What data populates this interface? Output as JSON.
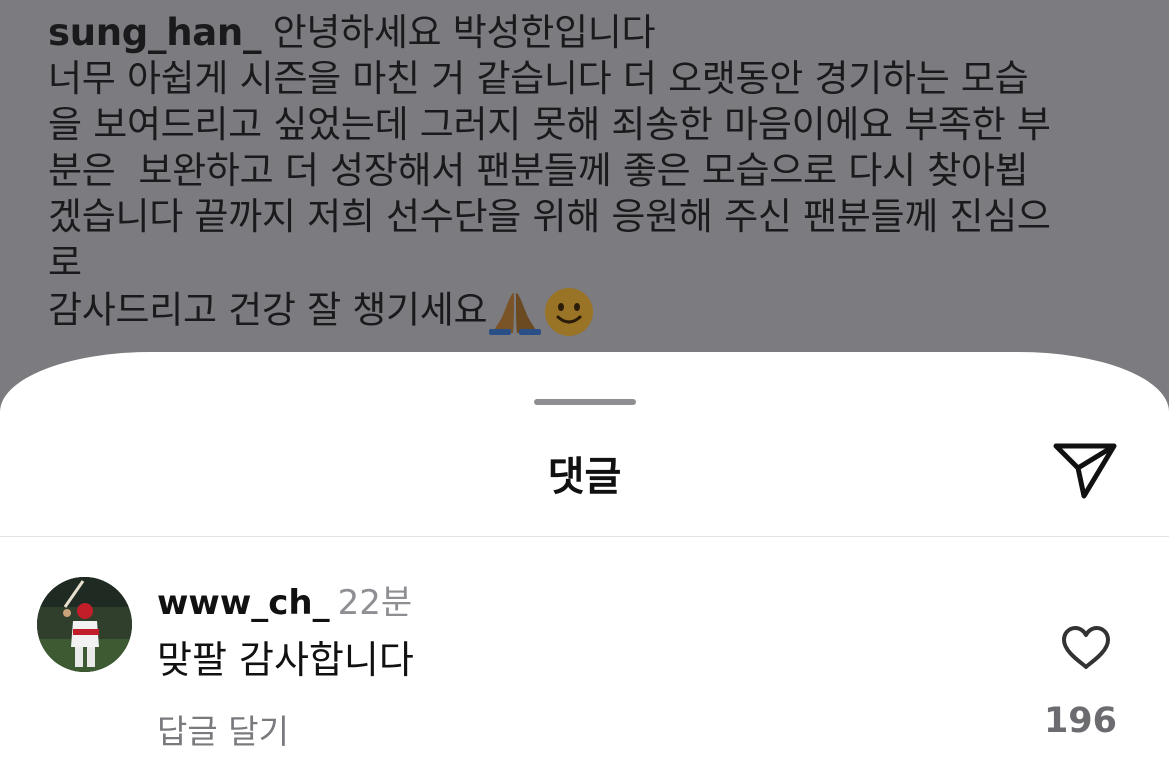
{
  "caption": {
    "username": "sung_han_",
    "line1": " 안녕하세요 박성한입니다",
    "line2": "너무 아쉽게 시즌을 마친 거 같습니다 더 오랫동안 경기하는 모습",
    "line3": "을 보여드리고 싶었는데 그러지 못해 죄송한 마음이에요 부족한 부",
    "line4": "분은  보완하고 더 성장해서 팬분들께 좋은 모습으로 다시 찾아뵙",
    "line5": "겠습니다 끝까지 저희 선수단을 위해 응원해 주신 팬분들께 진심으",
    "line6": "로",
    "line7": "감사드리고 건강 잘 챙기세요",
    "emojis": [
      "folded-hands",
      "slightly-smiling-face"
    ]
  },
  "sheet": {
    "title": "댓글",
    "share_icon": "paper-plane-icon"
  },
  "comment": {
    "username": "www_ch_",
    "time": "22분",
    "text": "맞팔 감사합니다",
    "reply_label": "답글 달기",
    "like_icon": "heart-outline-icon",
    "like_count": "196"
  },
  "colors": {
    "overlay": "#7b7b80",
    "sheet": "#ffffff",
    "text": "#111111",
    "muted": "#8e8e93"
  }
}
